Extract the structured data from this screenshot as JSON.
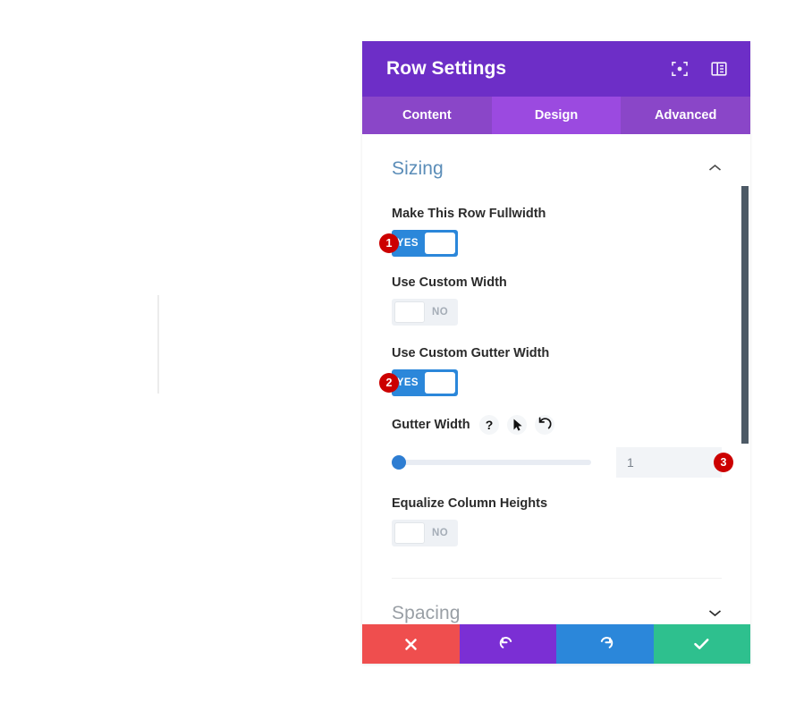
{
  "window": {
    "title": "Row Settings",
    "header_icons": [
      {
        "name": "focus-icon"
      },
      {
        "name": "panel-layout-icon"
      }
    ]
  },
  "tabs": [
    {
      "label": "Content",
      "active": false
    },
    {
      "label": "Design",
      "active": true
    },
    {
      "label": "Advanced",
      "active": false
    }
  ],
  "sections": {
    "sizing": {
      "title": "Sizing",
      "expanded": true,
      "chevron": "chevron-up-icon"
    },
    "spacing": {
      "title": "Spacing",
      "expanded": false,
      "chevron": "chevron-down-icon"
    }
  },
  "fields": {
    "fullwidth": {
      "label": "Make This Row Fullwidth",
      "value": "YES",
      "state": "on",
      "badge": "1"
    },
    "custom_width": {
      "label": "Use Custom Width",
      "value": "NO",
      "state": "off"
    },
    "custom_gutter_width": {
      "label": "Use Custom Gutter Width",
      "value": "YES",
      "state": "on",
      "badge": "2"
    },
    "gutter_width": {
      "label": "Gutter Width",
      "icons": [
        "help-icon",
        "cursor-pointer-icon",
        "reset-icon"
      ],
      "help_glyph": "?",
      "input_value": "1",
      "slider_percent": 0,
      "badge": "3"
    },
    "equalize_column_heights": {
      "label": "Equalize Column Heights",
      "value": "NO",
      "state": "off"
    }
  },
  "footer": {
    "buttons": [
      {
        "name": "cancel",
        "icon": "close-x-icon",
        "color": "#ef4e4e"
      },
      {
        "name": "undo",
        "icon": "undo-icon",
        "color": "#7b2fd4"
      },
      {
        "name": "redo",
        "icon": "redo-icon",
        "color": "#2b87da"
      },
      {
        "name": "save",
        "icon": "checkmark-icon",
        "color": "#2ec08e"
      }
    ]
  },
  "colors": {
    "header_purple": "#6d2ec7",
    "tabbar_purple": "#8a46c8",
    "active_tab_purple": "#9b4ae0",
    "toggle_on_blue": "#2b87da",
    "toggle_off_gray": "#eef1f5",
    "badge_red": "#cc0000",
    "section_title_blue": "#5b8db8",
    "slider_blue": "#2d7dd2",
    "scrollbar_thumb": "#4d5a66"
  }
}
